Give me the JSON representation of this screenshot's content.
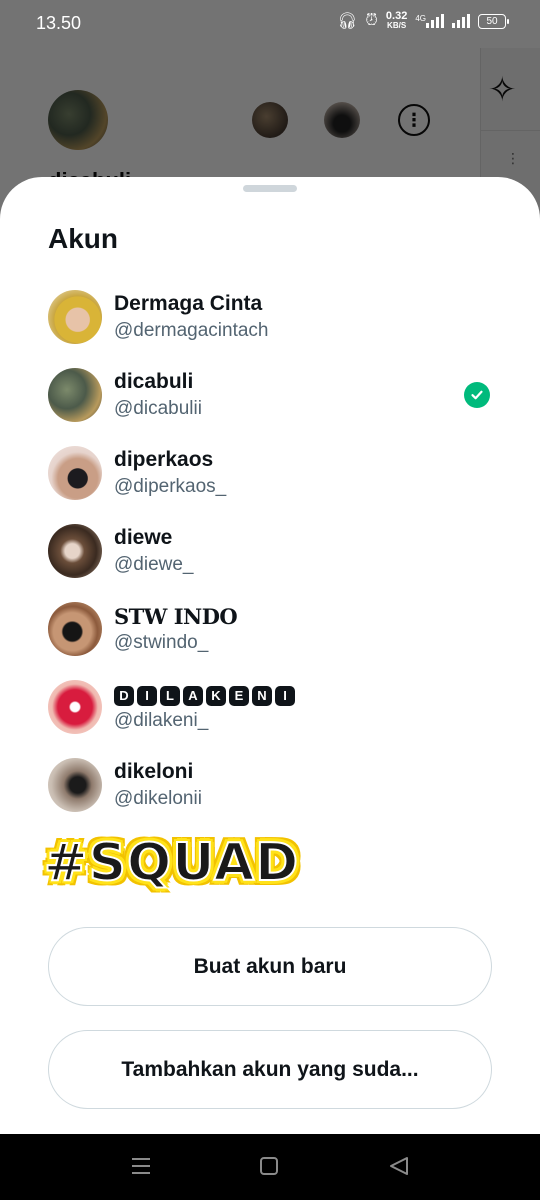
{
  "status_bar": {
    "time": "13.50",
    "net_speed_value": "0.32",
    "net_speed_unit": "KB/S",
    "network_type": "4G",
    "battery_level": "50"
  },
  "background": {
    "profile_name_partial": "dicabuli"
  },
  "sheet": {
    "title": "Akun",
    "accounts": [
      {
        "name": "Dermaga Cinta",
        "handle": "@dermagacintach",
        "selected": false
      },
      {
        "name": "dicabuli",
        "handle": "@dicabulii",
        "selected": true
      },
      {
        "name": "diperkaos",
        "handle": "@diperkaos_",
        "selected": false
      },
      {
        "name": "diewe",
        "handle": "@diewe_",
        "selected": false
      },
      {
        "name": "STW INDO",
        "handle": "@stwindo_",
        "selected": false
      },
      {
        "name": "DILAKENI",
        "handle": "@dilakeni_",
        "selected": false
      },
      {
        "name": "dikeloni",
        "handle": "@dikelonii",
        "selected": false
      }
    ],
    "sticker_text": "#SQUAD",
    "create_account_label": "Buat akun baru",
    "add_existing_label": "Tambahkan akun yang suda..."
  },
  "colors": {
    "accent_check": "#00ba7c",
    "handle_gray": "#536471",
    "button_border": "#cfd9de"
  },
  "icons": {
    "more": "more-options-icon",
    "sparkle": "sparkle-icon",
    "selected": "check-circle-icon",
    "nav_recents": "menu-icon",
    "nav_home": "home-square-icon",
    "nav_back": "back-triangle-icon"
  }
}
